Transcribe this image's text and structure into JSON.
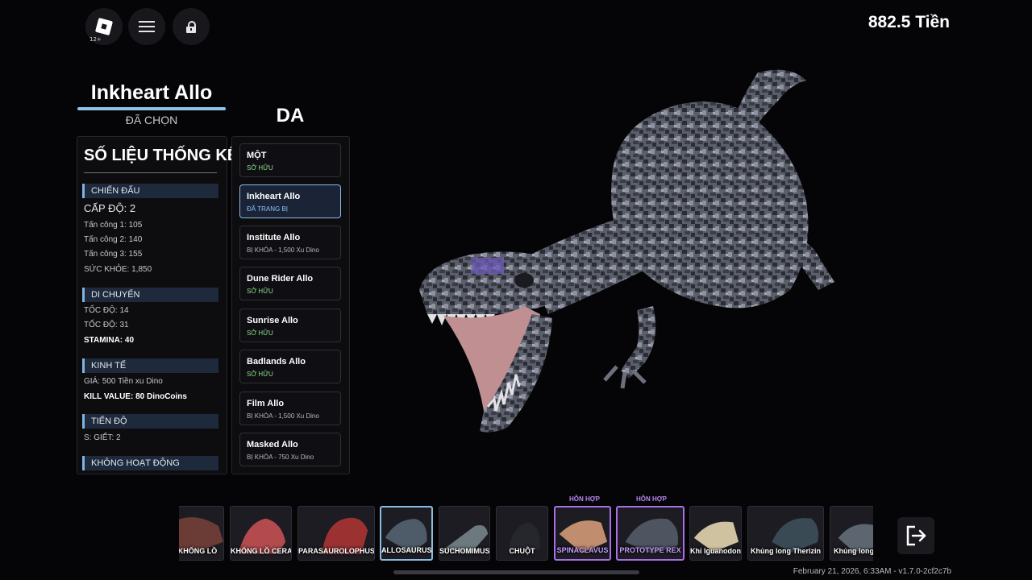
{
  "topbar": {
    "age_rating": "12+",
    "currency": "882.5 Tiền",
    "icons": [
      "roblox-logo-icon",
      "menu-icon",
      "lock-icon"
    ]
  },
  "dino": {
    "name": "Inkheart Allo",
    "status": "ĐÃ CHỌN"
  },
  "skins_title": "DA",
  "stats": {
    "heading": "SỐ LIỆU THỐNG KÊ",
    "combat": {
      "label": "CHIẾN ĐẤU",
      "level": "CẤP ĐỘ: 2",
      "attack1": "Tấn công 1: 105",
      "attack2": "Tấn công 2: 140",
      "attack3": "Tấn công 3: 155",
      "health": "SỨC KHỎE: 1,850"
    },
    "movement": {
      "label": "DI CHUYỂN",
      "speed1": "TỐC ĐỘ: 14",
      "speed2": "TỐC ĐỘ: 31",
      "stamina": "STAMINA: 40"
    },
    "economy": {
      "label": "KINH TẾ",
      "price": "GIÁ: 500 Tiền xu Dino",
      "kill_value": "KILL VALUE: 80 DinoCoins"
    },
    "progress": {
      "label": "TIẾN ĐỘ",
      "kills": "S: GIẾT: 2"
    },
    "inactive": {
      "label": "KHÔNG HOẠT ĐỘNG"
    }
  },
  "skins": [
    {
      "name": "MỘT",
      "status": "SỞ HỮU",
      "state": "owned"
    },
    {
      "name": "Inkheart Allo",
      "status": "ĐÃ TRANG BỊ",
      "state": "equipped"
    },
    {
      "name": "Institute Allo",
      "status": "BỊ KHÓA - 1,500 Xu Dino",
      "state": "locked"
    },
    {
      "name": "Dune Rider Allo",
      "status": "SỞ HỮU",
      "state": "owned"
    },
    {
      "name": "Sunrise Allo",
      "status": "SỞ HỮU",
      "state": "owned"
    },
    {
      "name": "Badlands Allo",
      "status": "SỞ HỮU",
      "state": "owned"
    },
    {
      "name": "Film Allo",
      "status": "BỊ KHÓA - 1,500 Xu Dino",
      "state": "locked"
    },
    {
      "name": "Masked Allo",
      "status": "BỊ KHÓA - 750 Xu Dino",
      "state": "locked"
    }
  ],
  "carousel": {
    "hybrid_badge": "HỖN HỢP",
    "cards": [
      {
        "label": "KHỔNG LỒ",
        "state": "normal"
      },
      {
        "label": "KHỔNG LỒ CERATO",
        "state": "normal"
      },
      {
        "label": "PARASAUROLOPHUS",
        "state": "normal"
      },
      {
        "label": "ALLOSAURUS",
        "state": "selected"
      },
      {
        "label": "SUCHOMIMUS",
        "state": "normal"
      },
      {
        "label": "CHUỘT",
        "state": "normal"
      },
      {
        "label": "SPINACLAVUS",
        "state": "hybrid"
      },
      {
        "label": "PROTOTYPE REX",
        "state": "hybrid"
      },
      {
        "label": "Khỉ Iguanodon",
        "state": "normal"
      },
      {
        "label": "Khủng long Therizin",
        "state": "normal"
      },
      {
        "label": "Khủng long c",
        "state": "normal"
      }
    ]
  },
  "footer": "February 21, 2026, 6:33AM - v1.7.0-2cf2c7b",
  "colors": {
    "accent_blue": "#8cbbe6",
    "hybrid_purple": "#a86fe6",
    "owned_green": "#8ee08a"
  }
}
